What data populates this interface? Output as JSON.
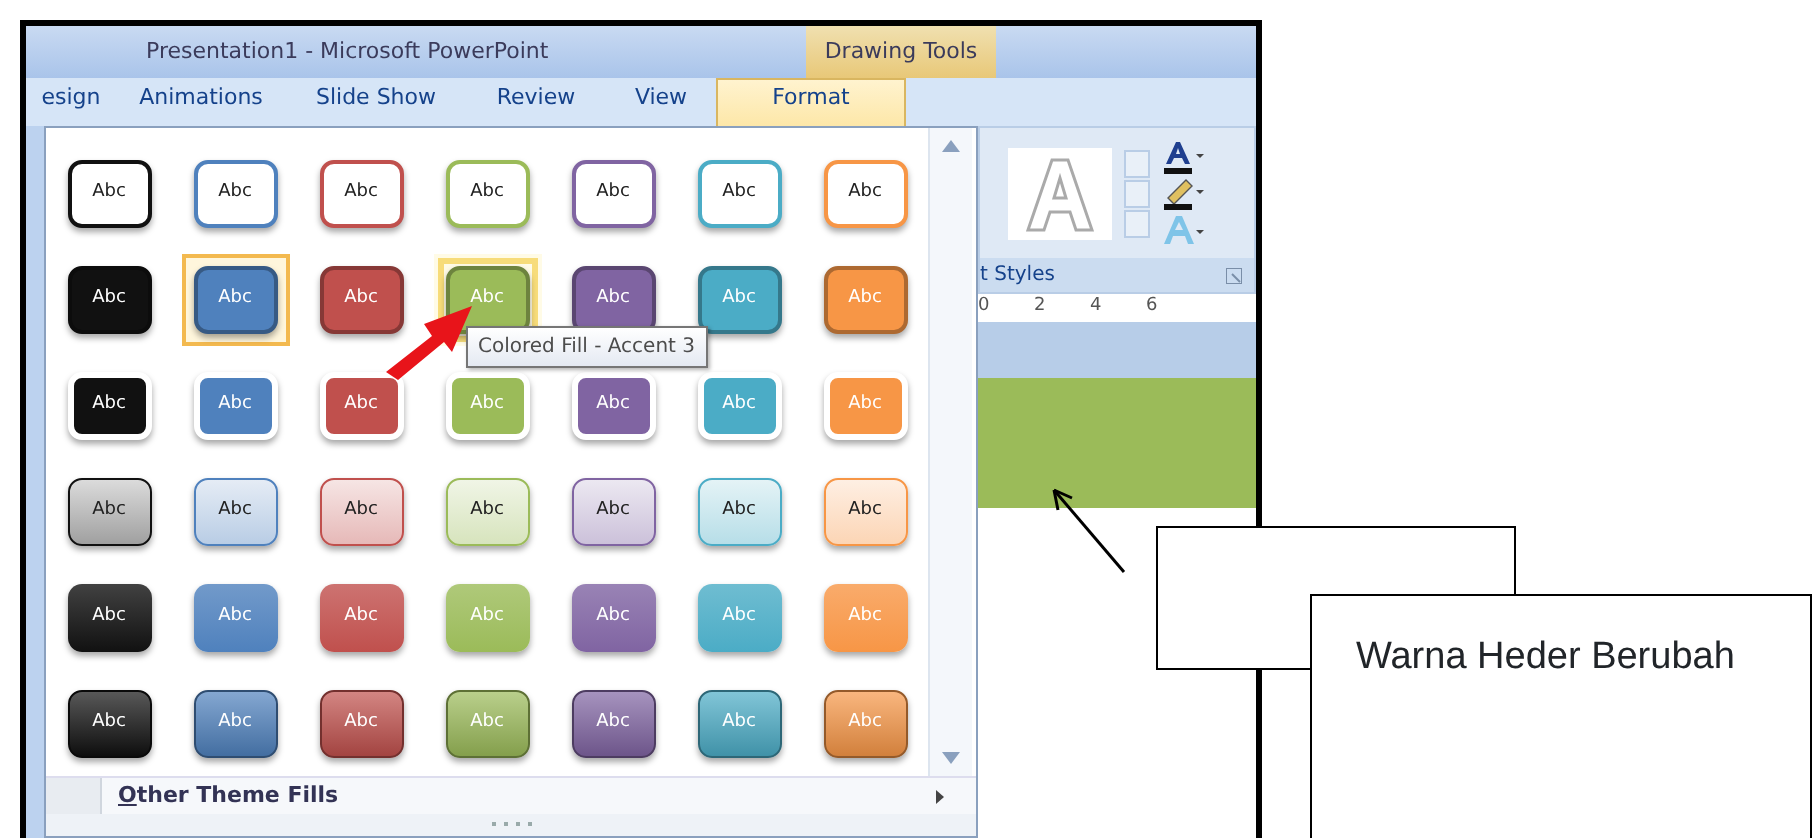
{
  "window": {
    "title": "Presentation1 - Microsoft PowerPoint",
    "context_tab": "Drawing Tools"
  },
  "tabs": [
    {
      "label": "esign",
      "selected": false
    },
    {
      "label": "Animations",
      "selected": false
    },
    {
      "label": "Slide Show",
      "selected": false
    },
    {
      "label": "Review",
      "selected": false
    },
    {
      "label": "View",
      "selected": false
    },
    {
      "label": "Format",
      "selected": true
    }
  ],
  "gallery": {
    "columns": [
      {
        "color": "#111111"
      },
      {
        "color": "#4f81bd"
      },
      {
        "color": "#c0504d"
      },
      {
        "color": "#9bbb59"
      },
      {
        "color": "#8064a2"
      },
      {
        "color": "#4bacc6"
      },
      {
        "color": "#f79646"
      }
    ],
    "rows": [
      {
        "kind": "outline",
        "swatches": [
          {
            "label": "Abc",
            "selected": false,
            "hovered": false
          },
          {
            "label": "Abc",
            "selected": false,
            "hovered": false
          },
          {
            "label": "Abc",
            "selected": false,
            "hovered": false
          },
          {
            "label": "Abc",
            "selected": false,
            "hovered": false
          },
          {
            "label": "Abc",
            "selected": false,
            "hovered": false
          },
          {
            "label": "Abc",
            "selected": false,
            "hovered": false
          },
          {
            "label": "Abc",
            "selected": false,
            "hovered": false
          }
        ]
      },
      {
        "kind": "colored-fill",
        "swatches": [
          {
            "label": "Abc",
            "selected": false,
            "hovered": false
          },
          {
            "label": "Abc",
            "selected": true,
            "hovered": false
          },
          {
            "label": "Abc",
            "selected": false,
            "hovered": false
          },
          {
            "label": "Abc",
            "selected": false,
            "hovered": true
          },
          {
            "label": "Abc",
            "selected": false,
            "hovered": false
          },
          {
            "label": "Abc",
            "selected": false,
            "hovered": false
          },
          {
            "label": "Abc",
            "selected": false,
            "hovered": false
          }
        ]
      },
      {
        "kind": "light-edge",
        "swatches": [
          {
            "label": "Abc",
            "selected": false,
            "hovered": false
          },
          {
            "label": "Abc",
            "selected": false,
            "hovered": false
          },
          {
            "label": "Abc",
            "selected": false,
            "hovered": false
          },
          {
            "label": "Abc",
            "selected": false,
            "hovered": false
          },
          {
            "label": "Abc",
            "selected": false,
            "hovered": false
          },
          {
            "label": "Abc",
            "selected": false,
            "hovered": false
          },
          {
            "label": "Abc",
            "selected": false,
            "hovered": false
          }
        ]
      },
      {
        "kind": "subtle",
        "swatches": [
          {
            "label": "Abc",
            "selected": false,
            "hovered": false
          },
          {
            "label": "Abc",
            "selected": false,
            "hovered": false
          },
          {
            "label": "Abc",
            "selected": false,
            "hovered": false
          },
          {
            "label": "Abc",
            "selected": false,
            "hovered": false
          },
          {
            "label": "Abc",
            "selected": false,
            "hovered": false
          },
          {
            "label": "Abc",
            "selected": false,
            "hovered": false
          },
          {
            "label": "Abc",
            "selected": false,
            "hovered": false
          }
        ]
      },
      {
        "kind": "moderate",
        "swatches": [
          {
            "label": "Abc",
            "selected": false,
            "hovered": false
          },
          {
            "label": "Abc",
            "selected": false,
            "hovered": false
          },
          {
            "label": "Abc",
            "selected": false,
            "hovered": false
          },
          {
            "label": "Abc",
            "selected": false,
            "hovered": false
          },
          {
            "label": "Abc",
            "selected": false,
            "hovered": false
          },
          {
            "label": "Abc",
            "selected": false,
            "hovered": false
          },
          {
            "label": "Abc",
            "selected": false,
            "hovered": false
          }
        ]
      },
      {
        "kind": "intense",
        "swatches": [
          {
            "label": "Abc",
            "selected": false,
            "hovered": false
          },
          {
            "label": "Abc",
            "selected": false,
            "hovered": false
          },
          {
            "label": "Abc",
            "selected": false,
            "hovered": false
          },
          {
            "label": "Abc",
            "selected": false,
            "hovered": false
          },
          {
            "label": "Abc",
            "selected": false,
            "hovered": false
          },
          {
            "label": "Abc",
            "selected": false,
            "hovered": false
          },
          {
            "label": "Abc",
            "selected": false,
            "hovered": false
          }
        ]
      }
    ],
    "footer": {
      "label": "Other Theme Fills"
    }
  },
  "tooltip": "Colored Fill - Accent 3",
  "ribbon": {
    "group_label": "t Styles",
    "ruler_numbers": [
      "0",
      "2",
      "4",
      "6"
    ]
  },
  "callout": "Warna Heder Berubah"
}
